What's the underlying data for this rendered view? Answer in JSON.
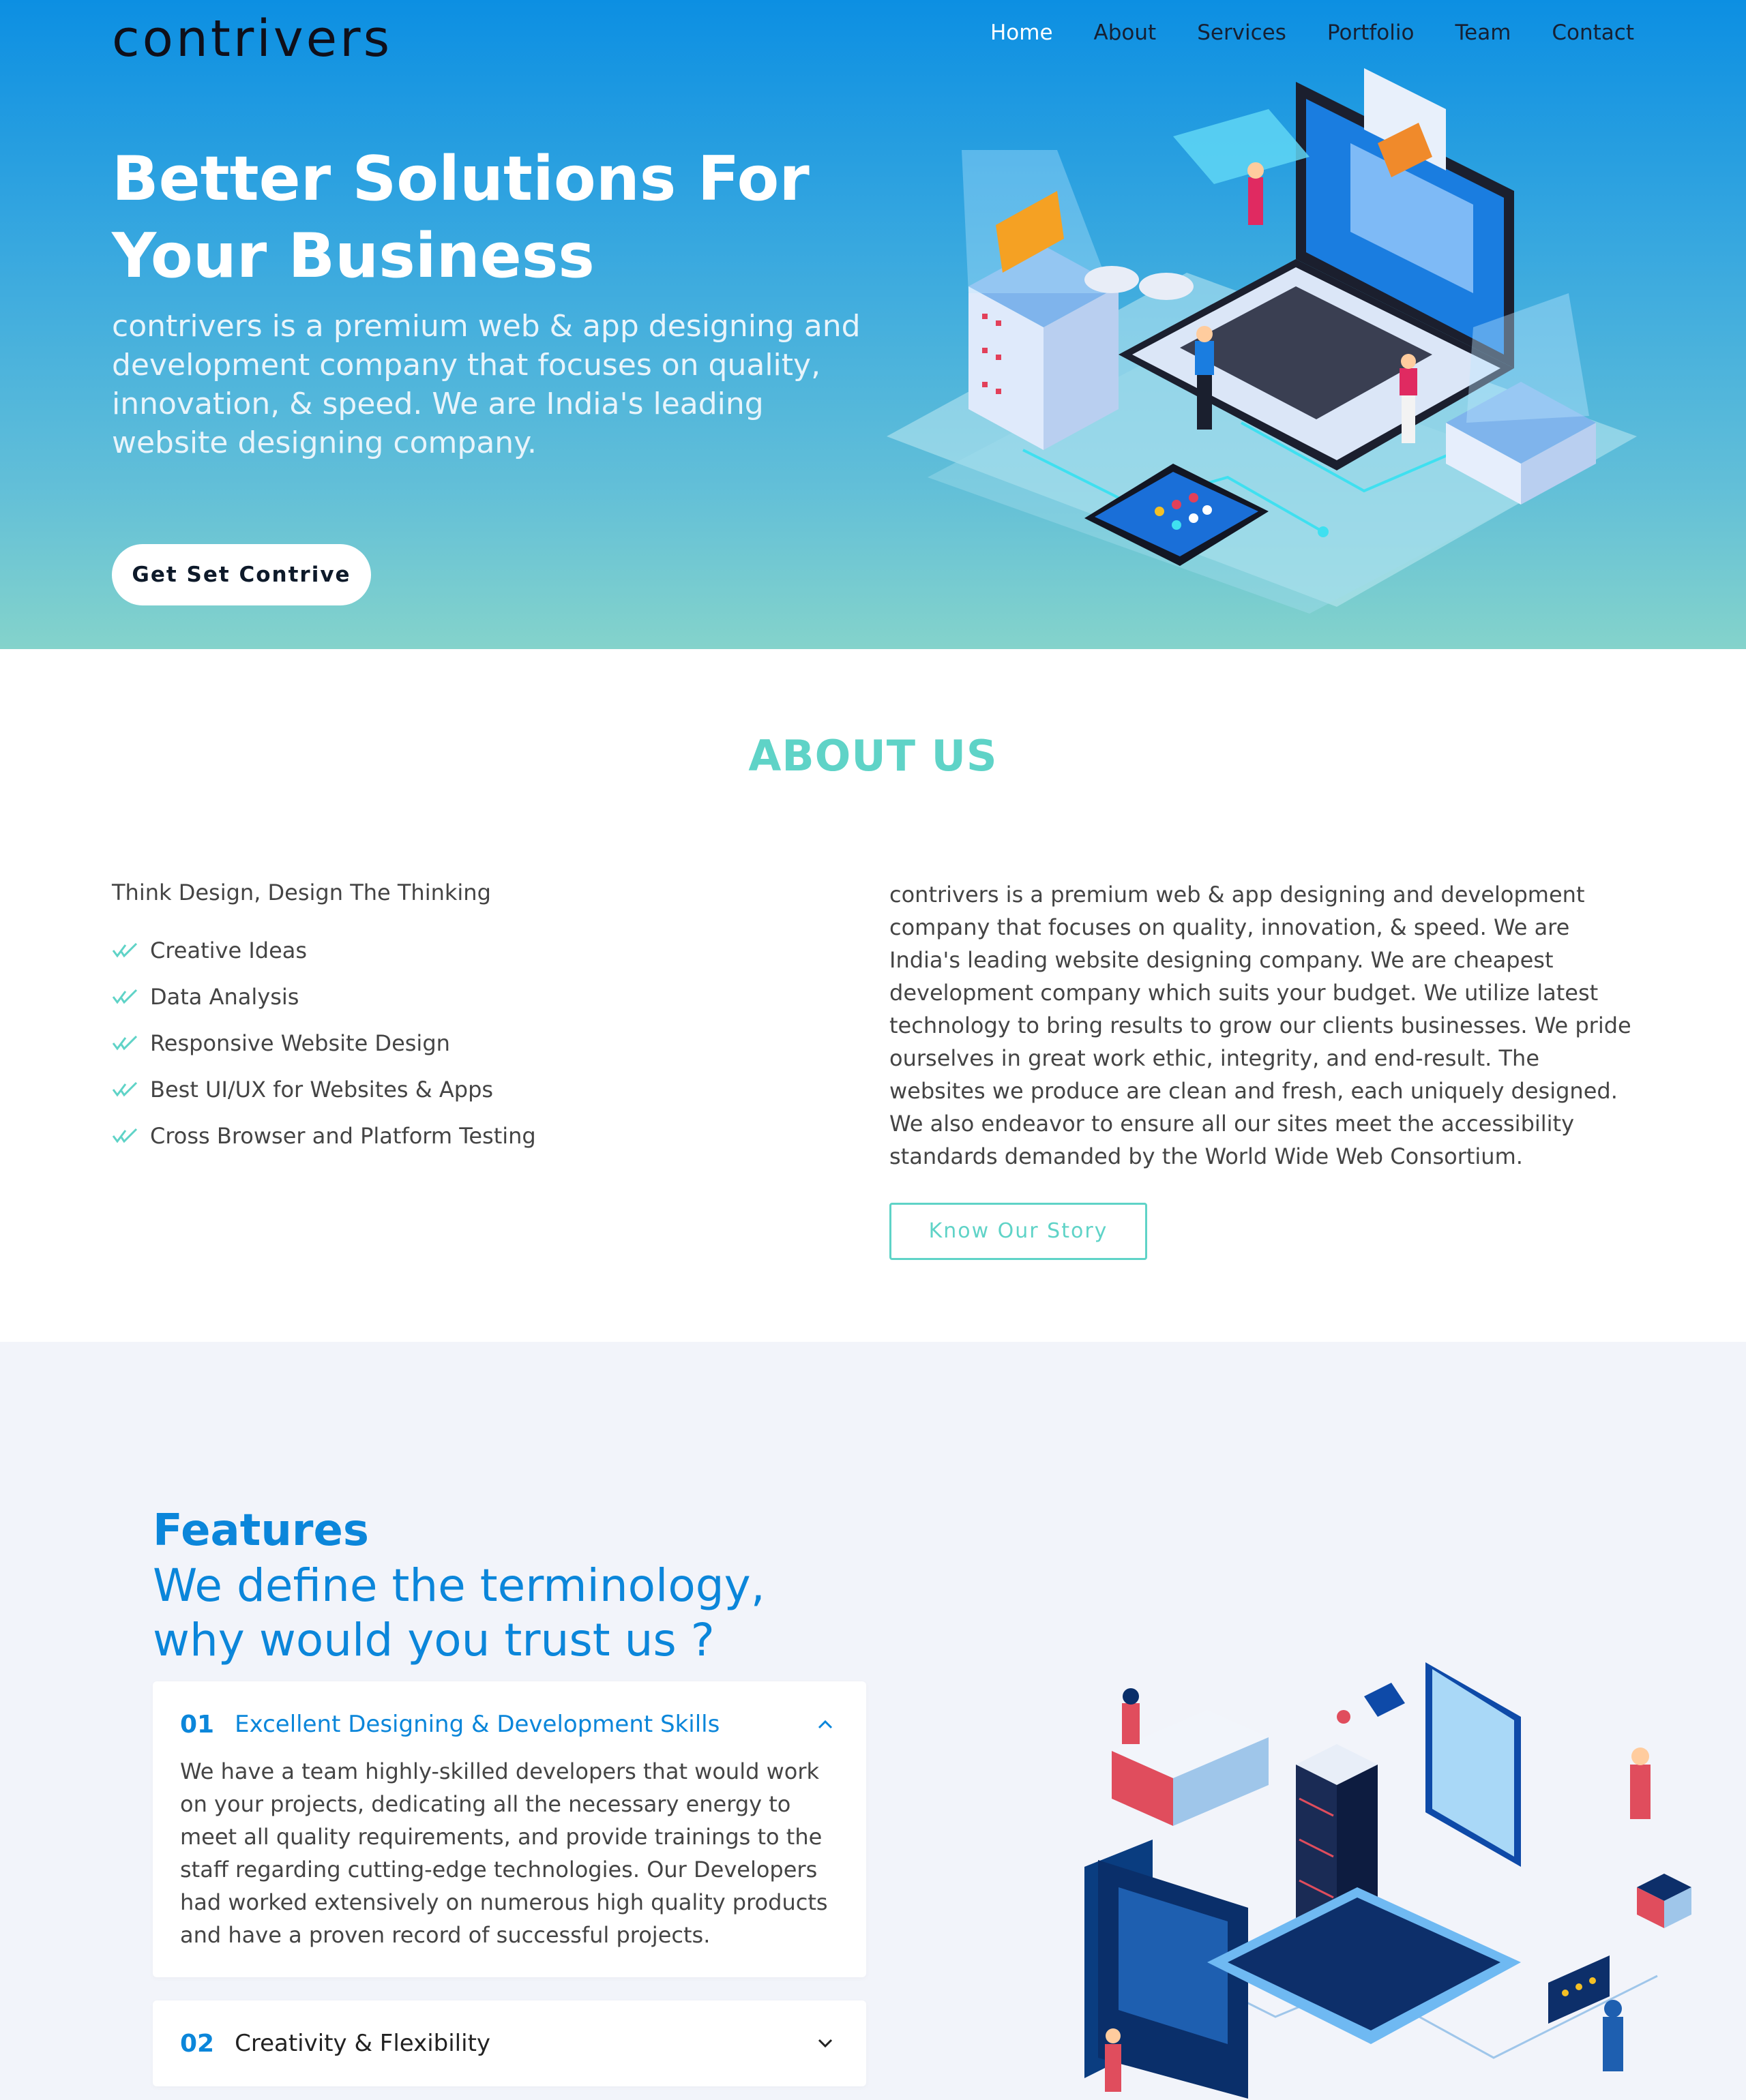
{
  "brand": {
    "logo": "contrivers"
  },
  "nav": {
    "items": [
      {
        "label": "Home"
      },
      {
        "label": "About"
      },
      {
        "label": "Services"
      },
      {
        "label": "Portfolio"
      },
      {
        "label": "Team"
      },
      {
        "label": "Contact"
      }
    ],
    "active": "Home"
  },
  "hero": {
    "title_line1": "Better Solutions For",
    "title_line2": "Your Business",
    "subtitle": "contrivers is a premium web & app designing and development company that focuses on quality, innovation, & speed. We are India's leading website designing company.",
    "cta": "Get Set Contrive"
  },
  "about": {
    "title": "ABOUT US",
    "lead": "Think Design, Design The Thinking",
    "list": [
      "Creative Ideas",
      "Data Analysis",
      "Responsive Website Design",
      "Best UI/UX for Websites & Apps",
      "Cross Browser and Platform Testing"
    ],
    "text": "contrivers is a premium web & app designing and development company that focuses on quality, innovation, & speed. We are India's leading website designing company. We are cheapest development company which suits your budget. We utilize latest technology to bring results to grow our clients businesses. We pride ourselves in great work ethic, integrity, and end-result. The websites we produce are clean and fresh, each uniquely designed. We also endeavor to ensure all our sites meet the accessibility standards demanded by the World Wide Web Consortium.",
    "button": "Know Our Story"
  },
  "features": {
    "title": "Features",
    "subtitle": "We define the terminology, why would you trust us ?",
    "items": [
      {
        "num": "01",
        "label": "Excellent Designing & Development Skills",
        "body": "We have a team highly-skilled developers that would work on your projects, dedicating all the necessary energy to meet all quality requirements, and provide trainings to the staff regarding cutting-edge technologies. Our Developers had worked extensively on numerous high quality products and have a proven record of successful projects.",
        "expanded": true
      },
      {
        "num": "02",
        "label": "Creativity & Flexibility",
        "expanded": false
      }
    ]
  },
  "colors": {
    "primary": "#0b86da",
    "accent": "#5fd3c7",
    "hero_top": "#0c8fe2",
    "hero_bottom": "#84d3cb",
    "features_bg": "#f2f4fa"
  }
}
